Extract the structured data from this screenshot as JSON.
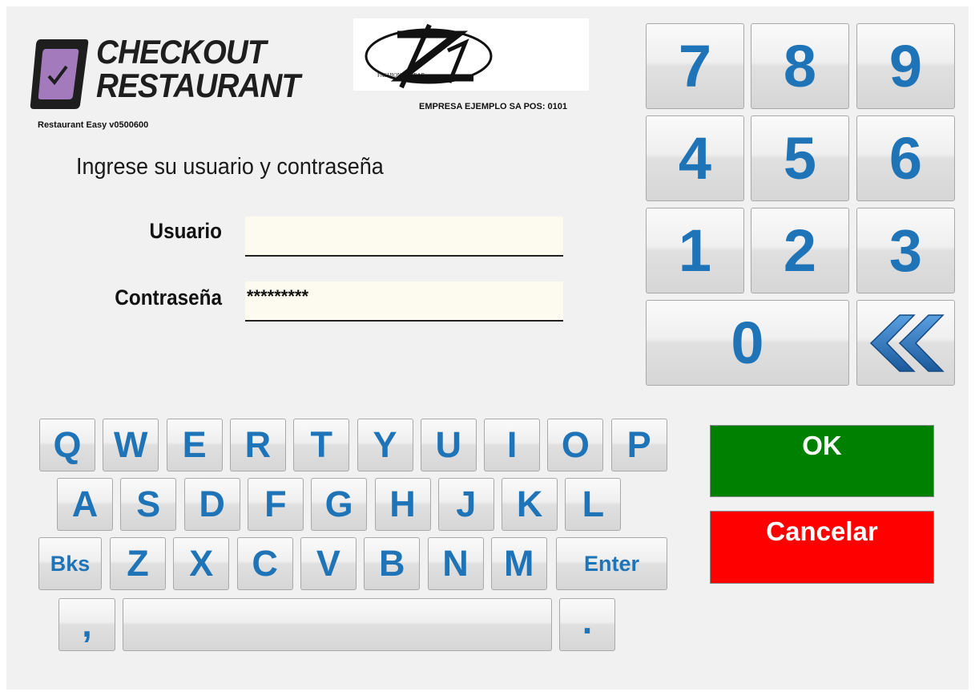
{
  "brand": {
    "line1": "CHECKOUT",
    "line2": "RESTAURANT",
    "version": "Restaurant Easy v0500600",
    "badge_color": "#a37bbd"
  },
  "company": {
    "logo_text": "FASHION & WEAR",
    "info": "EMPRESA EJEMPLO SA POS: 0101"
  },
  "login": {
    "prompt": "Ingrese su usuario y contraseña",
    "user_label": "Usuario",
    "user_value": "",
    "password_label": "Contraseña",
    "password_value": "*********"
  },
  "numpad": {
    "keys": [
      "7",
      "8",
      "9",
      "4",
      "5",
      "6",
      "1",
      "2",
      "3"
    ],
    "zero": "0",
    "back_icon": "double-chevron-left-icon"
  },
  "keyboard": {
    "row1": [
      "Q",
      "W",
      "E",
      "R",
      "T",
      "Y",
      "U",
      "I",
      "O",
      "P"
    ],
    "row2": [
      "A",
      "S",
      "D",
      "F",
      "G",
      "H",
      "J",
      "K",
      "L"
    ],
    "row3": [
      "Z",
      "X",
      "C",
      "V",
      "B",
      "N",
      "M"
    ],
    "backspace": "Bks",
    "enter": "Enter",
    "comma": ",",
    "period": "."
  },
  "actions": {
    "ok": "OK",
    "cancel": "Cancelar",
    "ok_color": "#008000",
    "cancel_color": "#ff0000"
  },
  "colors": {
    "key_text": "#1f74b8",
    "field_bg": "#fdfaef"
  }
}
